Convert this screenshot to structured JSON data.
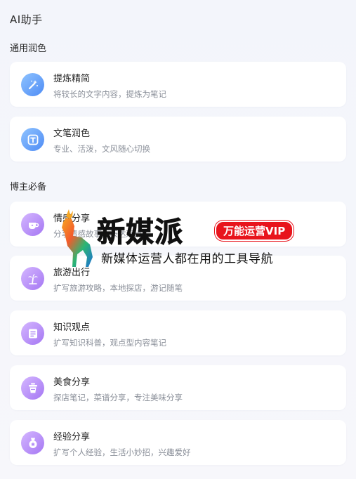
{
  "header": {
    "title": "AI助手"
  },
  "sections": [
    {
      "title": "通用润色",
      "items": [
        {
          "title": "提炼精简",
          "desc": "将较长的文字内容，提炼为笔记",
          "icon": "magic-wand-icon",
          "color": "#5b9bf8"
        },
        {
          "title": "文笔润色",
          "desc": "专业、活泼，文风随心切换",
          "icon": "text-t-icon",
          "color": "#5b9bf8"
        }
      ]
    },
    {
      "title": "博主必备",
      "items": [
        {
          "title": "情感分享",
          "desc": "分享情感故事，表达观点",
          "icon": "coffee-cup-icon",
          "color": "#b08af6"
        },
        {
          "title": "旅游出行",
          "desc": "扩写旅游攻略，本地探店，游记随笔",
          "icon": "palm-tree-icon",
          "color": "#b08af6"
        },
        {
          "title": "知识观点",
          "desc": "扩写知识科普，观点型内容笔记",
          "icon": "document-icon",
          "color": "#b08af6"
        },
        {
          "title": "美食分享",
          "desc": "探店笔记，菜谱分享，专注美味分享",
          "icon": "drink-cup-icon",
          "color": "#b08af6"
        },
        {
          "title": "经验分享",
          "desc": "扩写个人经验，生活小妙招，兴趣爱好",
          "icon": "medal-icon",
          "color": "#b08af6"
        }
      ]
    }
  ],
  "watermark": {
    "brand": "新媒派",
    "badge": "万能运营VIP",
    "tagline": "新媒体运营人都在用的工具导航"
  }
}
